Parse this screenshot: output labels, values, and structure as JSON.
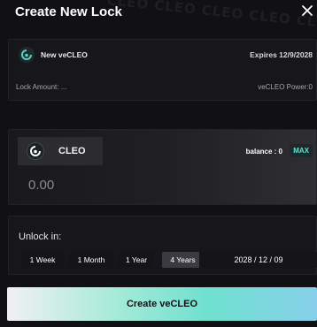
{
  "modal": {
    "title": "Create New Lock",
    "watermark": "CLEO CLEO CLEO CLEO CLEO"
  },
  "lock_info": {
    "name": "New veCLEO",
    "expires": "Expires 12/9/2028",
    "lock_amount": "Lock Amount: ...",
    "power": "veCLEO Power:0"
  },
  "amount": {
    "token": "CLEO",
    "balance": "balance  : 0",
    "max_label": "MAX",
    "placeholder": "0.00"
  },
  "unlock": {
    "label": "Unlock in:",
    "options": [
      "1 Week",
      "1 Month",
      "1 Year",
      "4 Years"
    ],
    "selected": "4 Years",
    "date": "2028 / 12 / 09"
  },
  "submit": {
    "label": "Create veCLEO"
  },
  "colors": {
    "accent": "#5ee3d6",
    "background": "#111114"
  }
}
